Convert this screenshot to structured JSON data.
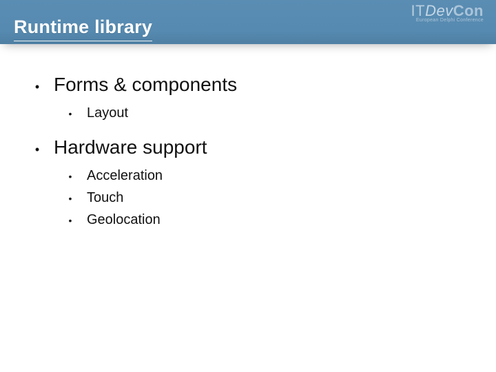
{
  "header": {
    "title": "Runtime library",
    "logo": {
      "part1": "IT",
      "part2": "Dev",
      "part3": "Con",
      "sub": "European Delphi Conference"
    }
  },
  "bullets": [
    {
      "label": "Forms & components",
      "children": [
        {
          "label": "Layout"
        }
      ]
    },
    {
      "label": "Hardware support",
      "children": [
        {
          "label": "Acceleration"
        },
        {
          "label": "Touch"
        },
        {
          "label": "Geolocation"
        }
      ]
    }
  ]
}
